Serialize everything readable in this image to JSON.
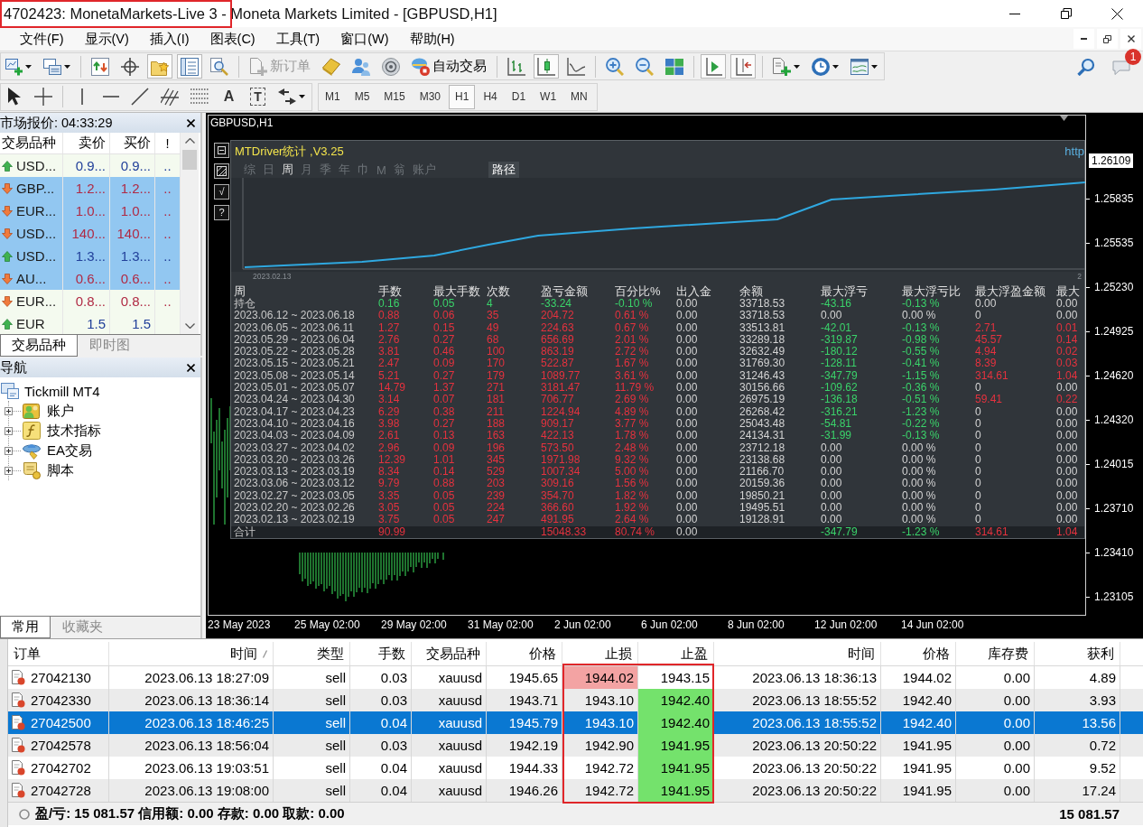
{
  "window": {
    "title": "4702423: MonetaMarkets-Live 3 - Moneta Markets Limited - [GBPUSD,H1]",
    "highlighted": true
  },
  "menu": [
    "文件(F)",
    "显示(V)",
    "插入(I)",
    "图表(C)",
    "工具(T)",
    "窗口(W)",
    "帮助(H)"
  ],
  "toolbar": {
    "items": [
      {
        "kind": "new-chart",
        "pressed": false,
        "dropdown": true
      },
      {
        "kind": "profiles",
        "pressed": false,
        "dropdown": true
      },
      {
        "kind": "separator"
      },
      {
        "kind": "market-watch",
        "pressed": false
      },
      {
        "kind": "data-window",
        "pressed": false
      },
      {
        "kind": "navigator",
        "pressed": true
      },
      {
        "kind": "terminal",
        "pressed": true
      },
      {
        "kind": "tester",
        "pressed": false
      },
      {
        "kind": "separator"
      },
      {
        "kind": "new-order",
        "label": "新订单",
        "pressed": false,
        "disabled": true
      },
      {
        "kind": "editor",
        "pressed": false
      },
      {
        "kind": "community",
        "pressed": false
      },
      {
        "kind": "signals",
        "pressed": false
      },
      {
        "kind": "auto-trading",
        "label": "自动交易",
        "pressed": false
      },
      {
        "kind": "separator"
      },
      {
        "kind": "bar-chart",
        "pressed": false
      },
      {
        "kind": "candle-chart",
        "pressed": true
      },
      {
        "kind": "line-chart",
        "pressed": false
      },
      {
        "kind": "separator"
      },
      {
        "kind": "zoom-in",
        "pressed": false
      },
      {
        "kind": "zoom-out",
        "pressed": false
      },
      {
        "kind": "tile",
        "pressed": false
      },
      {
        "kind": "separator"
      },
      {
        "kind": "auto-scroll",
        "pressed": true
      },
      {
        "kind": "chart-shift",
        "pressed": true
      },
      {
        "kind": "separator"
      },
      {
        "kind": "indicators",
        "pressed": false,
        "dropdown": true
      },
      {
        "kind": "periods",
        "pressed": false,
        "dropdown": true
      },
      {
        "kind": "templates",
        "pressed": false,
        "dropdown": true
      }
    ],
    "messages": {
      "badge": "1"
    }
  },
  "drawing_tools": {
    "items": [
      {
        "kind": "cursor",
        "pressed": false
      },
      {
        "kind": "crosshair",
        "pressed": false
      },
      {
        "kind": "separator"
      },
      {
        "kind": "vline",
        "pressed": false
      },
      {
        "kind": "hline",
        "pressed": false
      },
      {
        "kind": "trendline",
        "pressed": false
      },
      {
        "kind": "fib-channel",
        "pressed": false
      },
      {
        "kind": "fib-grid",
        "pressed": false
      },
      {
        "kind": "text",
        "glyph": "A",
        "pressed": false
      },
      {
        "kind": "label",
        "glyph": "T",
        "pressed": false
      },
      {
        "kind": "arrows",
        "pressed": false,
        "dropdown": true
      }
    ]
  },
  "timeframes": [
    {
      "label": "M1",
      "selected": false
    },
    {
      "label": "M5",
      "selected": false
    },
    {
      "label": "M15",
      "selected": false
    },
    {
      "label": "M30",
      "selected": false
    },
    {
      "label": "H1",
      "selected": true
    },
    {
      "label": "H4",
      "selected": false
    },
    {
      "label": "D1",
      "selected": false
    },
    {
      "label": "W1",
      "selected": false
    },
    {
      "label": "MN",
      "selected": false
    }
  ],
  "market_watch": {
    "title": "市场报价: 04:33:29",
    "columns": [
      "交易品种",
      "卖价",
      "买价",
      "!"
    ],
    "rows": [
      {
        "symbol": "USD...",
        "bid": "0.9...",
        "ask": "0.9...",
        "col_4": "..",
        "rising": true,
        "selected": false
      },
      {
        "symbol": "GBP...",
        "bid": "1.2...",
        "ask": "1.2...",
        "col_4": "..",
        "rising": false,
        "selected": true
      },
      {
        "symbol": "EUR...",
        "bid": "1.0...",
        "ask": "1.0...",
        "col_4": "..",
        "rising": false,
        "selected": true
      },
      {
        "symbol": "USD...",
        "bid": "140...",
        "ask": "140...",
        "col_4": "..",
        "rising": false,
        "selected": true
      },
      {
        "symbol": "USD...",
        "bid": "1.3...",
        "ask": "1.3...",
        "col_4": "..",
        "rising": true,
        "selected": true
      },
      {
        "symbol": "AU...",
        "bid": "0.6...",
        "ask": "0.6...",
        "col_4": "..",
        "rising": false,
        "selected": true
      },
      {
        "symbol": "EUR...",
        "bid": "0.8...",
        "ask": "0.8...",
        "col_4": "..",
        "rising": false,
        "selected": false
      },
      {
        "symbol": "EUR",
        "bid": "1.5",
        "ask": "1.5",
        "rising": true,
        "selected": false
      }
    ],
    "tabs": [
      {
        "label": "交易品种",
        "selected": true
      },
      {
        "label": "即时图",
        "selected": false
      }
    ]
  },
  "navigator": {
    "title": "导航",
    "root": {
      "label": "Tickmill MT4",
      "children": [
        {
          "label": "账户",
          "kind": "accounts",
          "expanded": false
        },
        {
          "label": "技术指标",
          "kind": "indicators",
          "expanded": false
        },
        {
          "label": "EA交易",
          "kind": "experts",
          "expanded": false
        },
        {
          "label": "脚本",
          "kind": "scripts",
          "expanded": false
        }
      ]
    },
    "tabs": [
      {
        "label": "常用",
        "selected": true
      },
      {
        "label": "收藏夹",
        "selected": false
      }
    ]
  },
  "chart": {
    "title": "GBPUSD,H1",
    "current_price": "1.26109",
    "price_labels": [
      "1.25835",
      "1.25535",
      "1.25230",
      "1.24925",
      "1.24620",
      "1.24320",
      "1.24015",
      "1.23710",
      "1.23410",
      "1.23105"
    ],
    "time_labels": [
      "23 May 2023",
      "25 May 02:00",
      "29 May 02:00",
      "31 May 02:00",
      "2 Jun 02:00",
      "6 Jun 02:00",
      "8 Jun 02:00",
      "12 Jun 02:00",
      "14 Jun 02:00"
    ]
  },
  "indicator": {
    "side_buttons": [
      {
        "kind": "minimize"
      },
      {
        "kind": "chart"
      },
      {
        "kind": "glyph",
        "glyph": "√"
      },
      {
        "kind": "glyph",
        "glyph": "?"
      }
    ],
    "title": "MTDriver统计 ,V3.25",
    "link": "http",
    "tabs": [
      {
        "label": "综",
        "selected": false
      },
      {
        "label": "日",
        "selected": false
      },
      {
        "label": "周",
        "selected": true
      },
      {
        "label": "月",
        "selected": false
      },
      {
        "label": "季",
        "selected": false
      },
      {
        "label": "年",
        "selected": false
      },
      {
        "label": "巾",
        "selected": false
      },
      {
        "label": "M",
        "selected": false
      },
      {
        "label": "翁",
        "selected": false
      },
      {
        "label": "账户",
        "selected": false
      }
    ],
    "path_button": "路径",
    "curve_start": "2023.02.13",
    "curve_end": "2",
    "columns": [
      "周",
      "手数",
      "最大手数",
      "次数",
      "盈亏金额",
      "百分比%",
      "出入金",
      "余额",
      "最大浮亏",
      "最大浮亏比",
      "最大浮盈金额",
      "最大"
    ],
    "rows": [
      {
        "kind": "open",
        "drawdown": true,
        "float_profit": false,
        "cells": [
          "持仓",
          "0.16",
          "0.05",
          "4",
          "-33.24",
          "-0.10 %",
          "0.00",
          "33718.53",
          "-43.16",
          "-0.13 %",
          "0.00",
          "0.00"
        ]
      },
      {
        "kind": "week",
        "drawdown": false,
        "float_profit": false,
        "cells": [
          "2023.06.12 ~ 2023.06.18",
          "0.88",
          "0.06",
          "35",
          "204.72",
          "0.61 %",
          "0.00",
          "33718.53",
          "0.00",
          "0.00 %",
          "0",
          "0.00"
        ]
      },
      {
        "kind": "week",
        "drawdown": true,
        "float_profit": true,
        "cells": [
          "2023.06.05 ~ 2023.06.11",
          "1.27",
          "0.15",
          "49",
          "224.63",
          "0.67 %",
          "0.00",
          "33513.81",
          "-42.01",
          "-0.13 %",
          "2.71",
          "0.01"
        ]
      },
      {
        "kind": "week",
        "drawdown": true,
        "float_profit": true,
        "cells": [
          "2023.05.29 ~ 2023.06.04",
          "2.76",
          "0.27",
          "68",
          "656.69",
          "2.01 %",
          "0.00",
          "33289.18",
          "-319.87",
          "-0.98 %",
          "45.57",
          "0.14"
        ]
      },
      {
        "kind": "week",
        "drawdown": true,
        "float_profit": true,
        "cells": [
          "2023.05.22 ~ 2023.05.28",
          "3.81",
          "0.46",
          "100",
          "863.19",
          "2.72 %",
          "0.00",
          "32632.49",
          "-180.12",
          "-0.55 %",
          "4.94",
          "0.02"
        ]
      },
      {
        "kind": "week",
        "drawdown": true,
        "float_profit": true,
        "cells": [
          "2023.05.15 ~ 2023.05.21",
          "2.47",
          "0.09",
          "170",
          "522.87",
          "1.67 %",
          "0.00",
          "31769.30",
          "-128.11",
          "-0.41 %",
          "8.39",
          "0.03"
        ]
      },
      {
        "kind": "week",
        "drawdown": true,
        "float_profit": true,
        "cells": [
          "2023.05.08 ~ 2023.05.14",
          "5.21",
          "0.27",
          "179",
          "1089.77",
          "3.61 %",
          "0.00",
          "31246.43",
          "-347.79",
          "-1.15 %",
          "314.61",
          "1.04"
        ]
      },
      {
        "kind": "week",
        "drawdown": true,
        "float_profit": false,
        "cells": [
          "2023.05.01 ~ 2023.05.07",
          "14.79",
          "1.37",
          "271",
          "3181.47",
          "11.79 %",
          "0.00",
          "30156.66",
          "-109.62",
          "-0.36 %",
          "0",
          "0.00"
        ]
      },
      {
        "kind": "week",
        "drawdown": true,
        "float_profit": true,
        "cells": [
          "2023.04.24 ~ 2023.04.30",
          "3.14",
          "0.07",
          "181",
          "706.77",
          "2.69 %",
          "0.00",
          "26975.19",
          "-136.18",
          "-0.51 %",
          "59.41",
          "0.22"
        ]
      },
      {
        "kind": "week",
        "drawdown": true,
        "float_profit": false,
        "cells": [
          "2023.04.17 ~ 2023.04.23",
          "6.29",
          "0.38",
          "211",
          "1224.94",
          "4.89 %",
          "0.00",
          "26268.42",
          "-316.21",
          "-1.23 %",
          "0",
          "0.00"
        ]
      },
      {
        "kind": "week",
        "drawdown": true,
        "float_profit": false,
        "cells": [
          "2023.04.10 ~ 2023.04.16",
          "3.98",
          "0.27",
          "188",
          "909.17",
          "3.77 %",
          "0.00",
          "25043.48",
          "-54.81",
          "-0.22 %",
          "0",
          "0.00"
        ]
      },
      {
        "kind": "week",
        "drawdown": true,
        "float_profit": false,
        "cells": [
          "2023.04.03 ~ 2023.04.09",
          "2.61",
          "0.13",
          "163",
          "422.13",
          "1.78 %",
          "0.00",
          "24134.31",
          "-31.99",
          "-0.13 %",
          "0",
          "0.00"
        ]
      },
      {
        "kind": "week",
        "drawdown": false,
        "float_profit": false,
        "cells": [
          "2023.03.27 ~ 2023.04.02",
          "2.96",
          "0.09",
          "196",
          "573.50",
          "2.48 %",
          "0.00",
          "23712.18",
          "0.00",
          "0.00 %",
          "0",
          "0.00"
        ]
      },
      {
        "kind": "week",
        "drawdown": false,
        "float_profit": false,
        "cells": [
          "2023.03.20 ~ 2023.03.26",
          "12.39",
          "1.01",
          "345",
          "1971.98",
          "9.32 %",
          "0.00",
          "23138.68",
          "0.00",
          "0.00 %",
          "0",
          "0.00"
        ]
      },
      {
        "kind": "week",
        "drawdown": false,
        "float_profit": false,
        "cells": [
          "2023.03.13 ~ 2023.03.19",
          "8.34",
          "0.14",
          "529",
          "1007.34",
          "5.00 %",
          "0.00",
          "21166.70",
          "0.00",
          "0.00 %",
          "0",
          "0.00"
        ]
      },
      {
        "kind": "week",
        "drawdown": false,
        "float_profit": false,
        "cells": [
          "2023.03.06 ~ 2023.03.12",
          "9.79",
          "0.88",
          "203",
          "309.16",
          "1.56 %",
          "0.00",
          "20159.36",
          "0.00",
          "0.00 %",
          "0",
          "0.00"
        ]
      },
      {
        "kind": "week",
        "drawdown": false,
        "float_profit": false,
        "cells": [
          "2023.02.27 ~ 2023.03.05",
          "3.35",
          "0.05",
          "239",
          "354.70",
          "1.82 %",
          "0.00",
          "19850.21",
          "0.00",
          "0.00 %",
          "0",
          "0.00"
        ]
      },
      {
        "kind": "week",
        "drawdown": false,
        "float_profit": false,
        "cells": [
          "2023.02.20 ~ 2023.02.26",
          "3.05",
          "0.05",
          "224",
          "366.60",
          "1.92 %",
          "0.00",
          "19495.51",
          "0.00",
          "0.00 %",
          "0",
          "0.00"
        ]
      },
      {
        "kind": "week",
        "drawdown": false,
        "float_profit": false,
        "cells": [
          "2023.02.13 ~ 2023.02.19",
          "3.75",
          "0.05",
          "247",
          "491.95",
          "2.64 %",
          "0.00",
          "19128.91",
          "0.00",
          "0.00 %",
          "0",
          "0.00"
        ]
      },
      {
        "kind": "total",
        "drawdown": true,
        "float_profit": true,
        "cells": [
          "合计",
          "90.99",
          null,
          null,
          "15048.33",
          "80.74 %",
          "0.00",
          null,
          "-347.79",
          "-1.23 %",
          "314.61",
          "1.04"
        ]
      }
    ]
  },
  "terminal": {
    "columns": [
      {
        "label": "订单",
        "sorted": false,
        "highlighted": false
      },
      {
        "label": "时间",
        "sorted": true,
        "highlighted": false
      },
      {
        "label": "类型",
        "sorted": false,
        "highlighted": false
      },
      {
        "label": "手数",
        "sorted": false,
        "highlighted": false
      },
      {
        "label": "交易品种",
        "sorted": false,
        "highlighted": false
      },
      {
        "label": "价格",
        "sorted": false,
        "highlighted": false
      },
      {
        "label": "止损",
        "sorted": false,
        "highlighted": true
      },
      {
        "label": "止盈",
        "sorted": false,
        "highlighted": true
      },
      {
        "label": "时间",
        "sorted": false,
        "highlighted": false
      },
      {
        "label": "价格",
        "sorted": false,
        "highlighted": false
      },
      {
        "label": "库存费",
        "sorted": false,
        "highlighted": false
      },
      {
        "label": "获利",
        "sorted": false,
        "highlighted": false
      }
    ],
    "rows": [
      {
        "selected": false,
        "sl_hit": true,
        "tp_hit": false,
        "cells": [
          "27042130",
          "2023.06.13 18:27:09",
          "sell",
          "0.03",
          "xauusd",
          "1945.65",
          "1944.02",
          "1943.15",
          "2023.06.13 18:36:13",
          "1944.02",
          "0.00",
          "4.89"
        ]
      },
      {
        "selected": false,
        "sl_hit": false,
        "tp_hit": true,
        "cells": [
          "27042330",
          "2023.06.13 18:36:14",
          "sell",
          "0.03",
          "xauusd",
          "1943.71",
          "1943.10",
          "1942.40",
          "2023.06.13 18:55:52",
          "1942.40",
          "0.00",
          "3.93"
        ]
      },
      {
        "selected": true,
        "sl_hit": false,
        "tp_hit": true,
        "cells": [
          "27042500",
          "2023.06.13 18:46:25",
          "sell",
          "0.04",
          "xauusd",
          "1945.79",
          "1943.10",
          "1942.40",
          "2023.06.13 18:55:52",
          "1942.40",
          "0.00",
          "13.56"
        ]
      },
      {
        "selected": false,
        "sl_hit": false,
        "tp_hit": true,
        "cells": [
          "27042578",
          "2023.06.13 18:56:04",
          "sell",
          "0.03",
          "xauusd",
          "1942.19",
          "1942.90",
          "1941.95",
          "2023.06.13 20:50:22",
          "1941.95",
          "0.00",
          "0.72"
        ]
      },
      {
        "selected": false,
        "sl_hit": false,
        "tp_hit": true,
        "cells": [
          "27042702",
          "2023.06.13 19:03:51",
          "sell",
          "0.04",
          "xauusd",
          "1944.33",
          "1942.72",
          "1941.95",
          "2023.06.13 20:50:22",
          "1941.95",
          "0.00",
          "9.52"
        ]
      },
      {
        "selected": false,
        "sl_hit": false,
        "tp_hit": true,
        "cells": [
          "27042728",
          "2023.06.13 19:08:00",
          "sell",
          "0.04",
          "xauusd",
          "1946.26",
          "1942.72",
          "1941.95",
          "2023.06.13 20:50:22",
          "1941.95",
          "0.00",
          "17.24"
        ]
      }
    ],
    "status": {
      "summary": "盈/亏: 15 081.57 信用额: 0.00 存款: 0.00 取款: 0.00",
      "total": "15 081.57"
    }
  }
}
